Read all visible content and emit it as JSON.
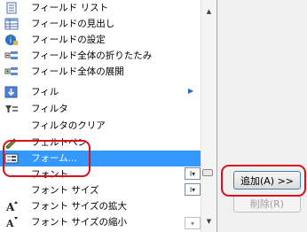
{
  "list": {
    "items": [
      {
        "icon": "field-list-icon",
        "label": "フィールド リスト"
      },
      {
        "icon": "field-headers-icon",
        "label": "フィールドの見出し"
      },
      {
        "icon": "field-settings-icon",
        "label": "フィールドの設定"
      },
      {
        "icon": "collapse-entire-field-icon",
        "label": "フィールド全体の折りたたみ"
      },
      {
        "icon": "expand-entire-field-icon",
        "label": "フィールド全体の展開"
      },
      {
        "icon": "fill-icon",
        "label": "フィル",
        "submenu": true
      },
      {
        "icon": "filter-icon",
        "label": "フィルタ"
      },
      {
        "icon": "",
        "label": "フィルタのクリア"
      },
      {
        "icon": "felt-pen-icon",
        "label": "フェルトペン"
      },
      {
        "icon": "form-icon",
        "label": "フォーム...",
        "selected": true
      },
      {
        "icon": "",
        "label": "フォント",
        "dropdown": true
      },
      {
        "icon": "",
        "label": "フォント サイズ",
        "dropdown": true
      },
      {
        "icon": "increase-font-size-icon",
        "label": "フォント サイズの拡大"
      },
      {
        "icon": "decrease-font-size-icon",
        "label": "フォント サイズの縮小"
      }
    ]
  },
  "buttons": {
    "add_label": "追加(A) >>",
    "remove_label": "削除(R)"
  },
  "colors": {
    "selection": "#3399ff",
    "highlight_outline": "#d8111b"
  }
}
